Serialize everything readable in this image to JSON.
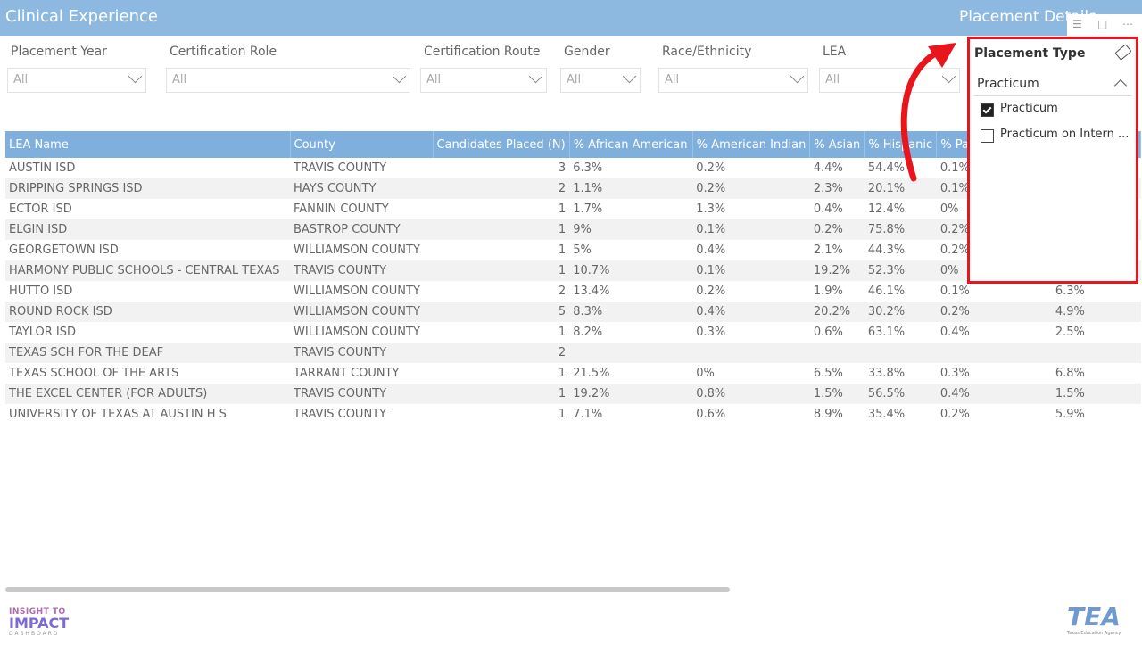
{
  "header": {
    "app_title": "Clinical Experience",
    "page_title": "Placement Details"
  },
  "visual_icons": [
    "filter-icon",
    "focus-mode-icon",
    "more-options-icon"
  ],
  "filters": [
    {
      "label": "Placement Year",
      "value": "All"
    },
    {
      "label": "Certification Role",
      "value": "All"
    },
    {
      "label": "Certification Route",
      "value": "All"
    },
    {
      "label": "Gender",
      "value": "All"
    },
    {
      "label": "Race/Ethnicity",
      "value": "All"
    },
    {
      "label": "LEA",
      "value": "All"
    }
  ],
  "slicer": {
    "title": "Placement Type",
    "selected": "Practicum",
    "options": [
      {
        "label": "Practicum",
        "checked": true
      },
      {
        "label": "Practicum on Intern ...",
        "checked": false
      }
    ]
  },
  "table": {
    "columns": [
      "LEA Name",
      "County",
      "Candidates Placed (N)",
      "% African American",
      "% American Indian",
      "% Asian",
      "% Hispanic",
      "% Pa",
      "",
      ""
    ],
    "rows": [
      [
        "AUSTIN ISD",
        "TRAVIS COUNTY",
        "3",
        "6.3%",
        "0.2%",
        "4.4%",
        "54.4%",
        "0.1%",
        "",
        ""
      ],
      [
        "DRIPPING SPRINGS ISD",
        "HAYS COUNTY",
        "2",
        "1.1%",
        "0.2%",
        "2.3%",
        "20.1%",
        "0.1%",
        "",
        ""
      ],
      [
        "ECTOR ISD",
        "FANNIN COUNTY",
        "1",
        "1.7%",
        "1.3%",
        "0.4%",
        "12.4%",
        "0%",
        "",
        ""
      ],
      [
        "ELGIN ISD",
        "BASTROP COUNTY",
        "1",
        "9%",
        "0.1%",
        "0.2%",
        "75.8%",
        "0.2%",
        "",
        ""
      ],
      [
        "GEORGETOWN ISD",
        "WILLIAMSON COUNTY",
        "1",
        "5%",
        "0.4%",
        "2.1%",
        "44.3%",
        "0.2%",
        "",
        ""
      ],
      [
        "HARMONY PUBLIC SCHOOLS - CENTRAL TEXAS",
        "TRAVIS COUNTY",
        "1",
        "10.7%",
        "0.1%",
        "19.2%",
        "52.3%",
        "0%",
        "",
        ""
      ],
      [
        "HUTTO ISD",
        "WILLIAMSON COUNTY",
        "2",
        "13.4%",
        "0.2%",
        "1.9%",
        "46.1%",
        "0.1%",
        "",
        "6.3%"
      ],
      [
        "ROUND ROCK ISD",
        "WILLIAMSON COUNTY",
        "5",
        "8.3%",
        "0.4%",
        "20.2%",
        "30.2%",
        "0.2%",
        "",
        "4.9%"
      ],
      [
        "TAYLOR ISD",
        "WILLIAMSON COUNTY",
        "1",
        "8.2%",
        "0.3%",
        "0.6%",
        "63.1%",
        "0.4%",
        "",
        "2.5%"
      ],
      [
        "TEXAS SCH FOR THE DEAF",
        "TRAVIS COUNTY",
        "2",
        "",
        "",
        "",
        "",
        "",
        "",
        ""
      ],
      [
        "TEXAS SCHOOL OF THE ARTS",
        "TARRANT COUNTY",
        "1",
        "21.5%",
        "0%",
        "6.5%",
        "33.8%",
        "0.3%",
        "",
        "6.8%"
      ],
      [
        "THE EXCEL CENTER (FOR ADULTS)",
        "TRAVIS COUNTY",
        "1",
        "19.2%",
        "0.8%",
        "1.5%",
        "56.5%",
        "0.4%",
        "",
        "1.5%"
      ],
      [
        "UNIVERSITY OF TEXAS AT AUSTIN H S",
        "TRAVIS COUNTY",
        "1",
        "7.1%",
        "0.6%",
        "8.9%",
        "35.4%",
        "0.2%",
        "",
        "5.9%"
      ]
    ]
  },
  "footer": {
    "left_logo": {
      "line1": "INSIGHT TO",
      "line2": "IMPACT",
      "line3": "DASHBOARD"
    },
    "right_logo": {
      "line1": "TEA",
      "line2": "Texas Education Agency"
    }
  },
  "colors": {
    "header_bg": "#8db9e0",
    "table_header_bg": "#7fb0dd",
    "highlight_border": "#e8151d",
    "arrow": "#e8151d"
  }
}
